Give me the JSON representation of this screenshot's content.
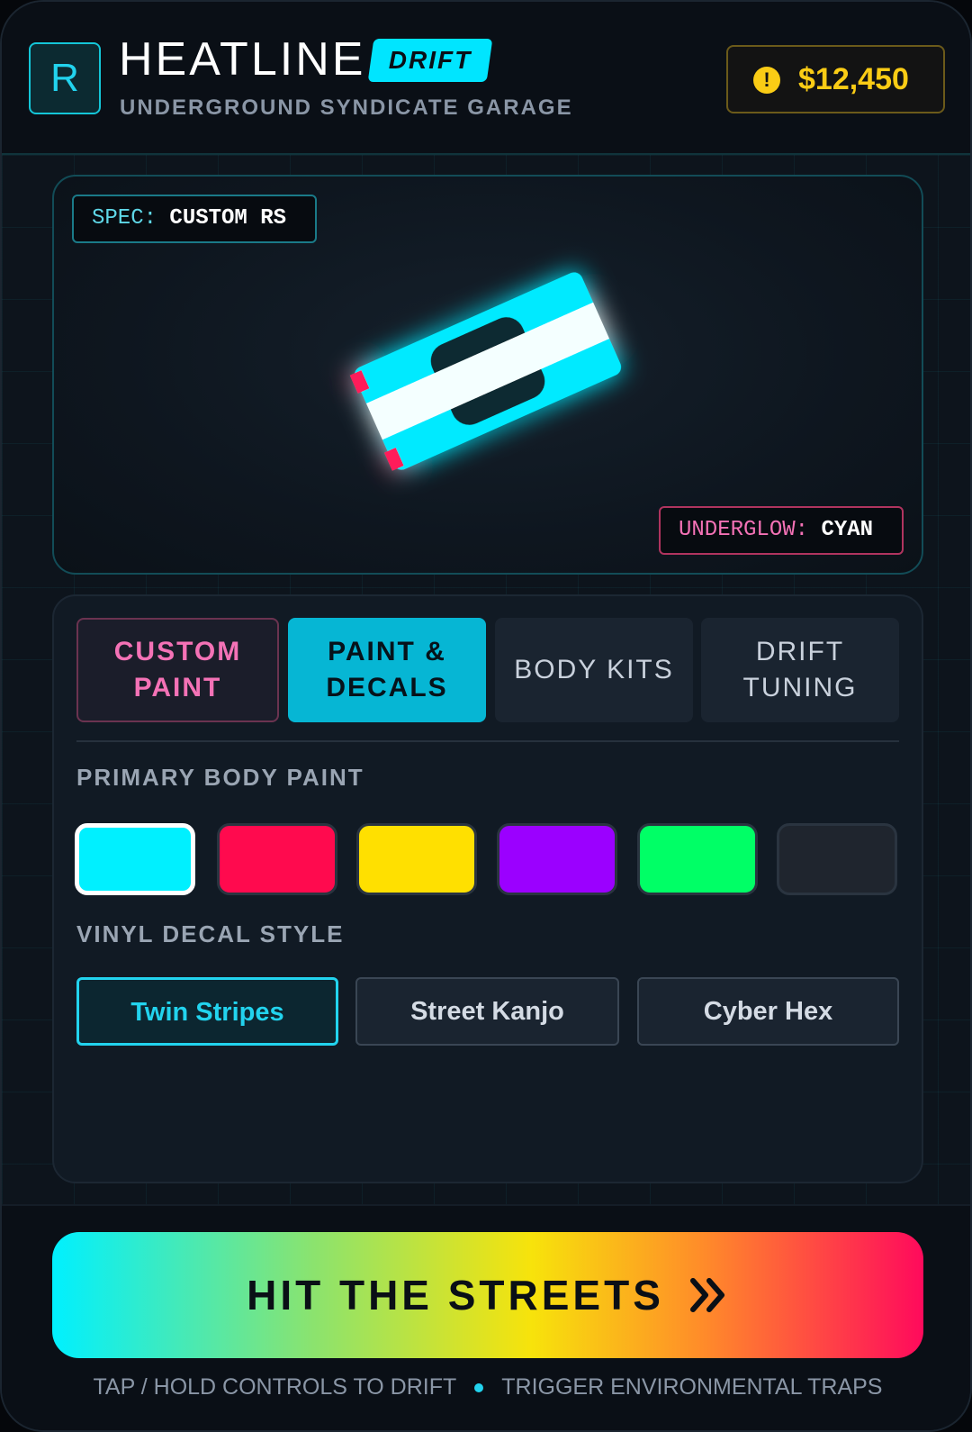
{
  "header": {
    "logo_letter": "R",
    "title": "HEATLINE",
    "tag": "DRIFT",
    "subtitle": "UNDERGROUND SYNDICATE GARAGE",
    "currency_icon": "coin-alert-icon",
    "currency_value": "$12,450"
  },
  "preview": {
    "spec_key": "SPEC:",
    "spec_value": "CUSTOM RS",
    "underglow_key": "UNDERGLOW:",
    "underglow_value": "CYAN",
    "car_color": "#00eaff",
    "stripe_color": "#f4ffff",
    "taillight_color": "#ff1f5a"
  },
  "tabs": [
    {
      "label_line1": "CUSTOM",
      "label_line2": "PAINT"
    },
    {
      "label_line1": "PAINT &",
      "label_line2": "DECALS",
      "active": true
    },
    {
      "label_line1": "BODY KITS",
      "label_line2": ""
    },
    {
      "label_line1": "DRIFT",
      "label_line2": "TUNING"
    }
  ],
  "paint": {
    "section_label": "PRIMARY BODY PAINT",
    "selected_index": 0,
    "swatches": [
      "#00f0ff",
      "#ff0a4e",
      "#ffe000",
      "#9b00ff",
      "#00ff66",
      "#1f252e"
    ]
  },
  "decals": {
    "section_label": "VINYL DECAL STYLE",
    "options": [
      "Twin Stripes",
      "Street Kanjo",
      "Cyber Hex"
    ],
    "selected_index": 0
  },
  "footer": {
    "cta_label": "HIT THE STREETS",
    "hint_left": "TAP / HOLD CONTROLS TO DRIFT",
    "hint_right": "TRIGGER ENVIRONMENTAL TRAPS"
  }
}
